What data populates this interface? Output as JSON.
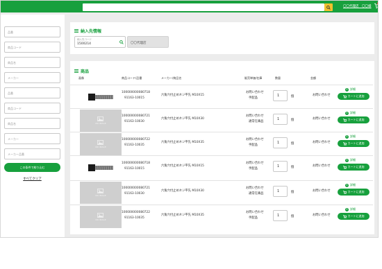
{
  "header": {
    "search_placeholder": "",
    "user_link": "〇〇代理店　〇〇様",
    "brand_color": "#17a03d",
    "search_button_color": "#f2c12e",
    "cart_badge_color": "#e53935"
  },
  "sidebar": {
    "fields": [
      "品番",
      "商品コード",
      "商品名",
      "メーカー",
      "品番",
      "商品コード",
      "商品名",
      "メーカー",
      "メーカー品番"
    ],
    "filter_button": "この条件で絞り込む",
    "clear_link": "すべてクリア"
  },
  "delivery": {
    "title": "納入先情報",
    "code_label": "納入先コード",
    "code_value": "1500214",
    "dealer_name": "〇〇代理店"
  },
  "products": {
    "title": "商品",
    "headers": {
      "image": "画像",
      "code": "商品コード/品番",
      "maker_name": "メーカー/商品名",
      "price": "販売単価/在庫",
      "qty": "数量",
      "amount": "金額"
    },
    "no_image_label": "NO IMAGE",
    "detail_label": "詳細",
    "cart_label": "カートに追加",
    "unit": "個",
    "rows": [
      {
        "code": "100000000080718",
        "part": "91163-10015",
        "name": "六角穴付止めネジ平先 M10X15",
        "price": "お問い合わせ",
        "stock": "手配品",
        "qty": "1",
        "amount": "お問い合わせ",
        "image": "product"
      },
      {
        "code": "100000000080721",
        "part": "91163-10030",
        "name": "六角穴付止めネジ平先 M10X30",
        "price": "お問い合わせ",
        "stock": "通常在庫品",
        "qty": "1",
        "amount": "お問い合わせ",
        "image": "none"
      },
      {
        "code": "100000000080722",
        "part": "91163-10035",
        "name": "六角穴付止めネジ平先 M10X35",
        "price": "お問い合わせ",
        "stock": "手配品",
        "qty": "1",
        "amount": "お問い合わせ",
        "image": "none"
      },
      {
        "code": "100000000080718",
        "part": "91163-10015",
        "name": "六角穴付止めネジ平先 M10X15",
        "price": "お問い合わせ",
        "stock": "手配品",
        "qty": "1",
        "amount": "お問い合わせ",
        "image": "product"
      },
      {
        "code": "100000000080721",
        "part": "91163-10030",
        "name": "六角穴付止めネジ平先 M10X30",
        "price": "お問い合わせ",
        "stock": "通常在庫品",
        "qty": "1",
        "amount": "お問い合わせ",
        "image": "none"
      },
      {
        "code": "100000000080722",
        "part": "91163-10035",
        "name": "六角穴付止めネジ平先 M10X35",
        "price": "お問い合わせ",
        "stock": "手配品",
        "qty": "1",
        "amount": "お問い合わせ",
        "image": "none"
      }
    ]
  }
}
